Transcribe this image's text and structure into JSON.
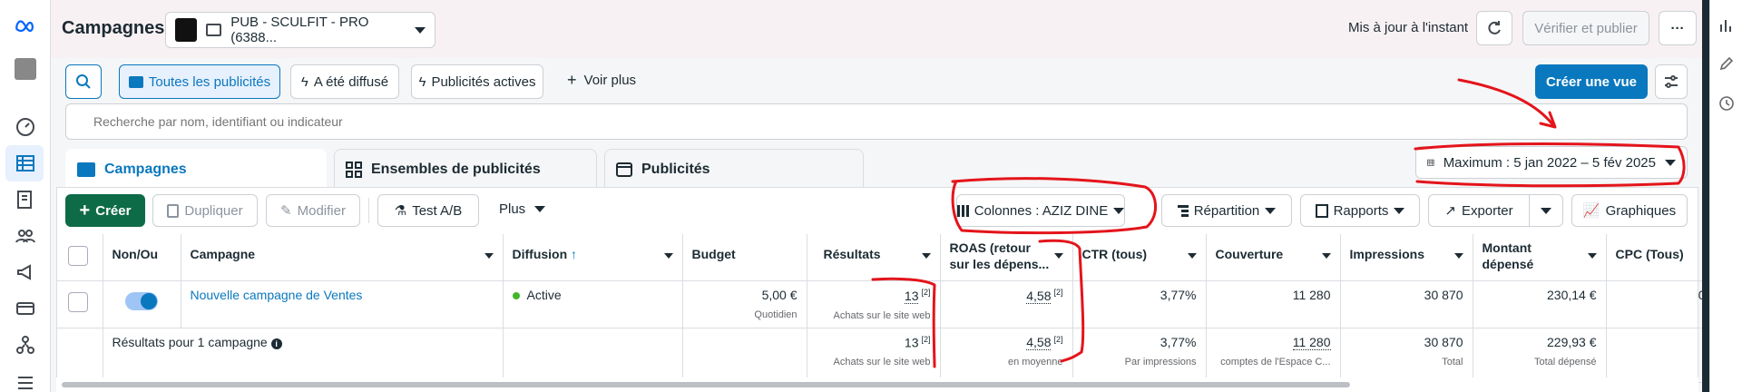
{
  "header": {
    "title": "Campagnes",
    "account_name": "PUB - SCULFIT - PRO (6388...",
    "status_text": "Mis à jour à l'instant",
    "publish_label": "Vérifier et publier"
  },
  "filters": {
    "all_ads": "Toutes les publicités",
    "was_delivered": "A été diffusé",
    "active_ads": "Publicités actives",
    "see_more": "Voir plus",
    "create_view": "Créer une vue"
  },
  "search": {
    "placeholder": "Recherche par nom, identifiant ou indicateur"
  },
  "tabs": [
    {
      "label": "Campagnes"
    },
    {
      "label": "Ensembles de publicités"
    },
    {
      "label": "Publicités"
    }
  ],
  "date_range": "Maximum : 5 jan 2022 – 5 fév 2025",
  "toolbar": {
    "create": "Créer",
    "duplicate": "Dupliquer",
    "edit": "Modifier",
    "ab_test": "Test A/B",
    "more": "Plus",
    "columns": "Colonnes : AZIZ DINE",
    "breakdown": "Répartition",
    "reports": "Rapports",
    "export": "Exporter",
    "charts": "Graphiques"
  },
  "table": {
    "headers": {
      "toggle": "Non/Ou",
      "campaign": "Campagne",
      "delivery": "Diffusion",
      "budget": "Budget",
      "results": "Résultats",
      "roas_l1": "ROAS (retour",
      "roas_l2": "sur les dépens...",
      "ctr": "CTR (tous)",
      "reach": "Couverture",
      "impressions": "Impressions",
      "spent_l1": "Montant",
      "spent_l2": "dépensé",
      "cpc": "CPC (Tous)"
    },
    "row": {
      "campaign": "Nouvelle campagne de Ventes",
      "delivery": "Active",
      "budget": "5,00 €",
      "budget_sub": "Quotidien",
      "results": "13",
      "results_note": "[2]",
      "results_sub": "Achats sur le site web",
      "roas": "4,58",
      "roas_note": "[2]",
      "ctr": "3,77%",
      "reach": "11 280",
      "impressions": "30 870",
      "spent": "230,14 €",
      "cpc": "0"
    },
    "summary": {
      "label": "Résultats pour 1 campagne",
      "results": "13",
      "results_note": "[2]",
      "results_sub": "Achats sur le site web",
      "roas": "4,58",
      "roas_note": "[2]",
      "roas_sub": "en moyenne",
      "ctr": "3,77%",
      "ctr_sub": "Par impressions",
      "reach": "11 280",
      "reach_sub": "comptes de l'Espace C...",
      "impressions": "30 870",
      "impressions_sub": "Total",
      "spent": "229,93 €",
      "spent_sub": "Total dépensé"
    }
  },
  "colors": {
    "primary_blue": "#0a78be",
    "create_green": "#0e6b47",
    "active_dot": "#42b72a",
    "annotation_red": "#e4141b"
  }
}
